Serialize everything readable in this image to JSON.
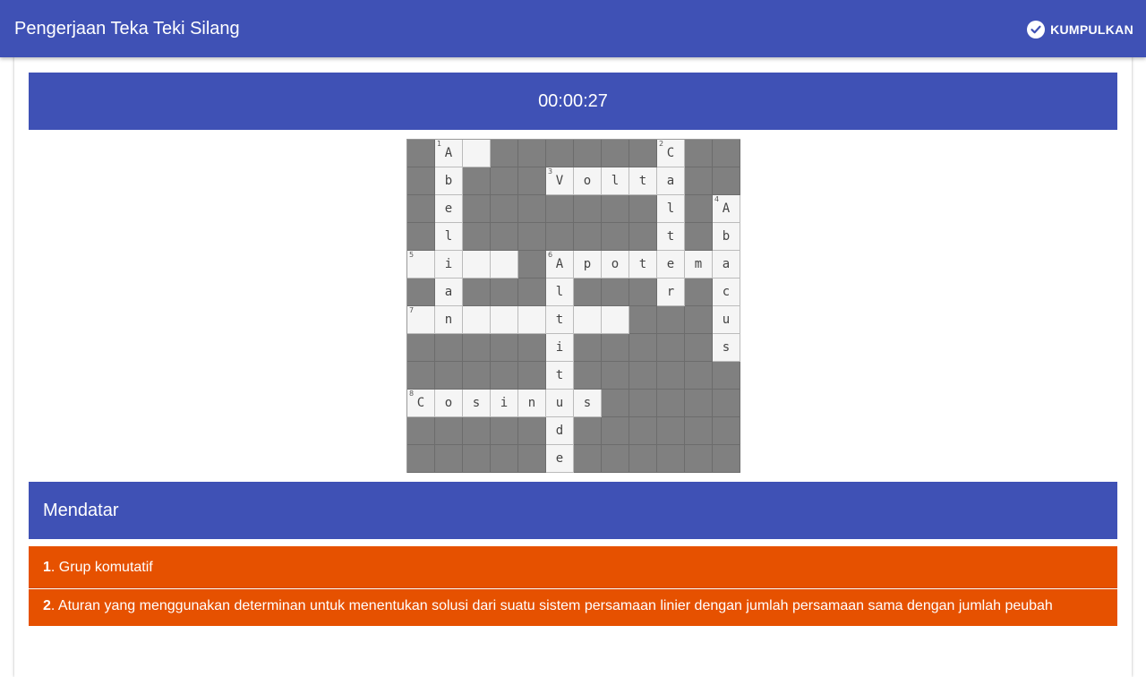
{
  "appbar": {
    "title": "Pengerjaan Teka Teki Silang",
    "submit_label": "KUMPULKAN",
    "submit_icon": "check-circle-icon"
  },
  "timer": "00:00:27",
  "grid": {
    "rows": [
      "#A?####C##",
      "#b###Volta##",
      "#e######l#A",
      "#l######t#b",
      "?i??#Apotema",
      "#a###l###r#c",
      "?n???t??###u",
      "#####i#####s",
      "#####t######",
      "Cosinus#####",
      "#####d######",
      "#####e######"
    ],
    "cells": [
      [
        "#",
        "A",
        "",
        "#",
        "#",
        "#",
        "#",
        "#",
        "#",
        "C",
        "#",
        "#"
      ],
      [
        "#",
        "b",
        "#",
        "#",
        "#",
        "V",
        "o",
        "l",
        "t",
        "a",
        "#",
        "#"
      ],
      [
        "#",
        "e",
        "#",
        "#",
        "#",
        "#",
        "#",
        "#",
        "#",
        "l",
        "#",
        "A"
      ],
      [
        "#",
        "l",
        "#",
        "#",
        "#",
        "#",
        "#",
        "#",
        "#",
        "t",
        "#",
        "b"
      ],
      [
        "",
        "i",
        "",
        "",
        "#",
        "A",
        "p",
        "o",
        "t",
        "e",
        "m",
        "a"
      ],
      [
        "#",
        "a",
        "#",
        "#",
        "#",
        "l",
        "#",
        "#",
        "#",
        "r",
        "#",
        "c"
      ],
      [
        "",
        "n",
        "",
        "",
        "",
        "t",
        "",
        "",
        "#",
        "#",
        "#",
        "u"
      ],
      [
        "#",
        "#",
        "#",
        "#",
        "#",
        "i",
        "#",
        "#",
        "#",
        "#",
        "#",
        "s"
      ],
      [
        "#",
        "#",
        "#",
        "#",
        "#",
        "t",
        "#",
        "#",
        "#",
        "#",
        "#",
        "#"
      ],
      [
        "C",
        "o",
        "s",
        "i",
        "n",
        "u",
        "s",
        "#",
        "#",
        "#",
        "#",
        "#"
      ],
      [
        "#",
        "#",
        "#",
        "#",
        "#",
        "d",
        "#",
        "#",
        "#",
        "#",
        "#",
        "#"
      ],
      [
        "#",
        "#",
        "#",
        "#",
        "#",
        "e",
        "#",
        "#",
        "#",
        "#",
        "#",
        "#"
      ]
    ],
    "numbers": [
      {
        "r": 0,
        "c": 1,
        "n": "1"
      },
      {
        "r": 0,
        "c": 9,
        "n": "2"
      },
      {
        "r": 1,
        "c": 5,
        "n": "3"
      },
      {
        "r": 2,
        "c": 11,
        "n": "4"
      },
      {
        "r": 4,
        "c": 0,
        "n": "5"
      },
      {
        "r": 4,
        "c": 5,
        "n": "6"
      },
      {
        "r": 6,
        "c": 0,
        "n": "7"
      },
      {
        "r": 9,
        "c": 0,
        "n": "8"
      }
    ]
  },
  "section": {
    "title": "Mendatar"
  },
  "clues": [
    {
      "num": "1",
      "text": ". Grup komutatif"
    },
    {
      "num": "2",
      "text": ". Aturan yang menggunakan determinan untuk menentukan solusi dari suatu sistem persamaan linier dengan jumlah persamaan sama dengan jumlah peubah"
    }
  ],
  "colors": {
    "primary": "#3f51b5",
    "accent": "#e65100",
    "block": "#808080"
  }
}
